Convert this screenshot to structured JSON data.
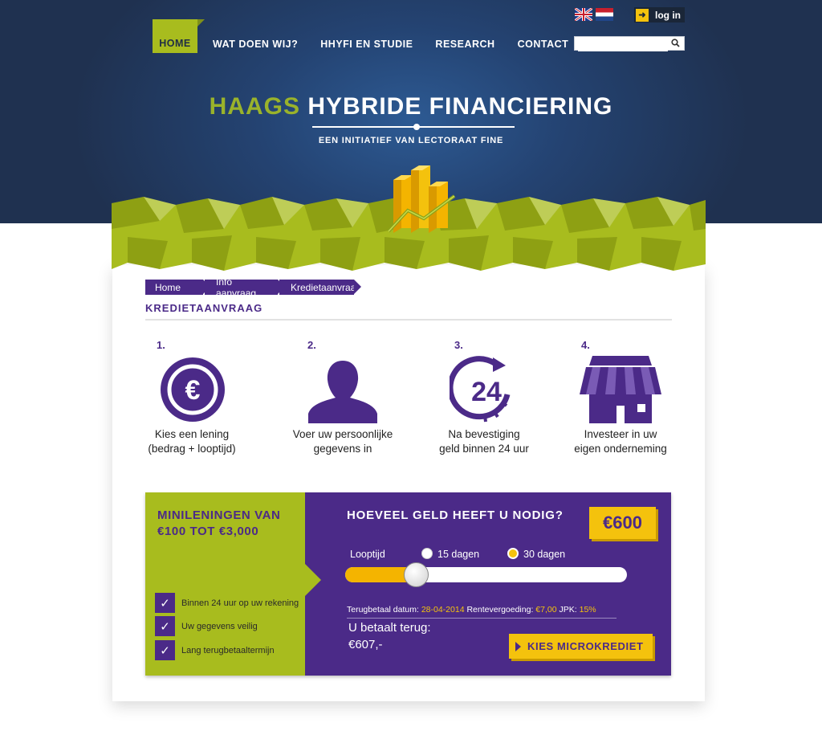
{
  "header": {
    "login_label": "log in",
    "languages": [
      "English",
      "Nederlands"
    ],
    "search": {
      "placeholder": "",
      "value": ""
    }
  },
  "nav": {
    "items": [
      "HOME",
      "WAT DOEN WIJ?",
      "HHYFI EN STUDIE",
      "RESEARCH",
      "CONTACT"
    ]
  },
  "brand": {
    "word1": "HAAGS",
    "word2": "HYBRIDE FINANCIERING",
    "tagline": "EEN INITIATIEF VAN LECTORAAT FINE"
  },
  "breadcrumb": [
    "Home",
    "Info aanvraag",
    "Kredietaanvraag"
  ],
  "page_title": "KREDIETAANVRAAG",
  "steps": [
    {
      "num": "1.",
      "icon": "euro-coin-icon",
      "line1": "Kies een lening",
      "line2": "(bedrag + looptijd)"
    },
    {
      "num": "2.",
      "icon": "person-icon",
      "line1": "Voer uw persoonlijke",
      "line2": "gegevens in"
    },
    {
      "num": "3.",
      "icon": "24-hours-icon",
      "icon_text": "24",
      "line1": "Na bevestiging",
      "line2": "geld binnen 24 uur"
    },
    {
      "num": "4.",
      "icon": "shop-icon",
      "line1": "Investeer in uw",
      "line2": "eigen onderneming"
    }
  ],
  "calculator": {
    "promo_title": "MINILENINGEN VAN €100 TOT €3,000",
    "benefits": [
      "Binnen 24 uur op uw rekening",
      "Uw gegevens veilig",
      "Lang terugbetaaltermijn"
    ],
    "question": "HOEVEEL GELD HEEFT U NODIG?",
    "amount": "€600",
    "term_label": "Looptijd",
    "term_options": [
      {
        "label": "15 dagen",
        "selected": false
      },
      {
        "label": "30 dagen",
        "selected": true
      }
    ],
    "slider_fraction": 0.25,
    "repay_date_label": "Terugbetaal datum:",
    "repay_date": "28-04-2014",
    "interest_label": "Rentevergoeding:",
    "interest": "€7,00",
    "apr_label": "JPK:",
    "apr": "15%",
    "pay_back_label": "U betaalt terug:",
    "pay_back_value": "€607,-",
    "cta_label": "KIES MICROKREDIET"
  },
  "colors": {
    "navy": "#223250",
    "purple": "#4b2a88",
    "lime": "#a8bc1e",
    "yellow": "#f4c20d"
  }
}
